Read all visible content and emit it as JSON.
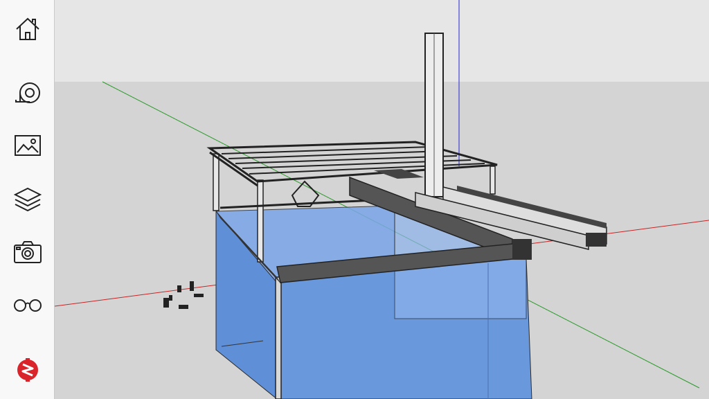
{
  "app": {
    "accent_color": "#d8242a",
    "sky_color": "#e6e6e6",
    "ground_color": "#d4d4d4"
  },
  "sidebar": {
    "items": [
      {
        "icon": "home-icon"
      },
      {
        "icon": "tape-measure-icon"
      },
      {
        "icon": "image-icon"
      },
      {
        "icon": "layers-icon"
      },
      {
        "icon": "camera-icon"
      },
      {
        "icon": "glasses-icon"
      },
      {
        "icon": "app-logo-icon"
      }
    ]
  },
  "scene": {
    "description_colors": {
      "glass": "#6f9ee3",
      "frame": "#2a2a2a",
      "beam_dark": "#555555",
      "axis_x": "#cc2222",
      "axis_y": "#2a9a2a",
      "axis_z": "#2222cc"
    }
  }
}
